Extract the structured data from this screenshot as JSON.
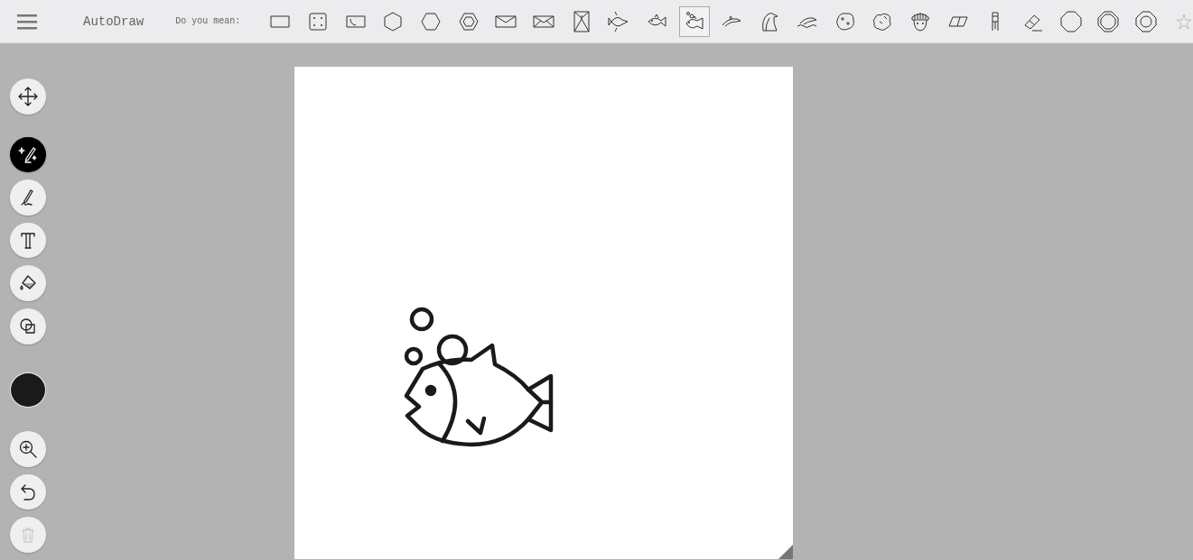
{
  "app_title": "AutoDraw",
  "suggestions": {
    "prompt": "Do you mean:",
    "items": [
      {
        "kind": "rectangle",
        "selected": false
      },
      {
        "kind": "dice",
        "selected": false
      },
      {
        "kind": "frame",
        "selected": false
      },
      {
        "kind": "hexagon",
        "selected": false
      },
      {
        "kind": "hexagonwide",
        "selected": false
      },
      {
        "kind": "nut",
        "selected": false
      },
      {
        "kind": "envelope",
        "selected": false
      },
      {
        "kind": "envelopeopen",
        "selected": false
      },
      {
        "kind": "crate",
        "selected": false
      },
      {
        "kind": "angelfish",
        "selected": false
      },
      {
        "kind": "fish",
        "selected": false
      },
      {
        "kind": "fishbubbles",
        "selected": true
      },
      {
        "kind": "dolphin",
        "selected": false
      },
      {
        "kind": "penguin",
        "selected": false
      },
      {
        "kind": "wave",
        "selected": false
      },
      {
        "kind": "blob",
        "selected": false
      },
      {
        "kind": "blobspiky",
        "selected": false
      },
      {
        "kind": "face",
        "selected": false
      },
      {
        "kind": "parallelogram",
        "selected": false
      },
      {
        "kind": "chair",
        "selected": false
      },
      {
        "kind": "eraser",
        "selected": false
      },
      {
        "kind": "octagon",
        "selected": false
      },
      {
        "kind": "octagondouble",
        "selected": false
      },
      {
        "kind": "octagonring",
        "selected": false
      },
      {
        "kind": "star",
        "selected": false
      }
    ]
  },
  "tools": [
    {
      "kind": "move",
      "selected": false,
      "disabled": false
    },
    {
      "kind": "autodraw",
      "selected": true,
      "disabled": false
    },
    {
      "kind": "pencil",
      "selected": false,
      "disabled": false
    },
    {
      "kind": "text",
      "selected": false,
      "disabled": false
    },
    {
      "kind": "fill",
      "selected": false,
      "disabled": false
    },
    {
      "kind": "shape",
      "selected": false,
      "disabled": false
    },
    {
      "kind": "color",
      "color": "#1a1a1a"
    },
    {
      "kind": "zoom",
      "selected": false,
      "disabled": false
    },
    {
      "kind": "undo",
      "selected": false,
      "disabled": false
    },
    {
      "kind": "trash",
      "selected": false,
      "disabled": true
    }
  ]
}
